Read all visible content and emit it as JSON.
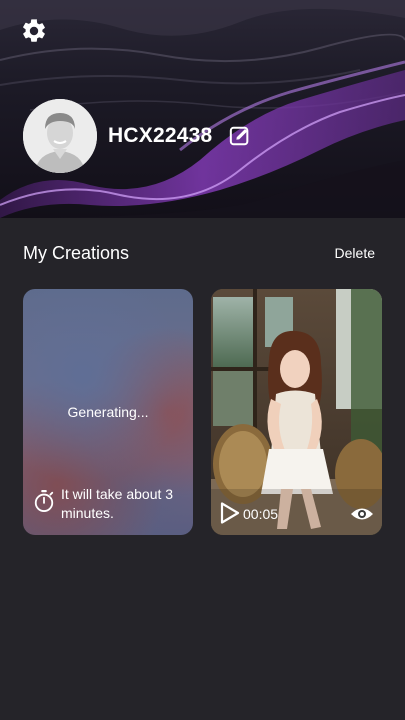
{
  "header": {
    "settings_icon": "gear-icon",
    "avatar_icon": "avatar-placeholder",
    "username": "HCX22438",
    "edit_icon": "pencil-edit-icon"
  },
  "section": {
    "title": "My Creations",
    "delete_label": "Delete"
  },
  "creations": [
    {
      "status": "Generating...",
      "eta": "It will take about 3 minutes.",
      "icon": "stopwatch-icon"
    },
    {
      "duration": "00:05",
      "play_icon": "play-icon",
      "view_icon": "eye-icon"
    }
  ],
  "colors": {
    "background": "#252429",
    "wave_accent": "#8e3fc7",
    "text": "#ffffff"
  }
}
